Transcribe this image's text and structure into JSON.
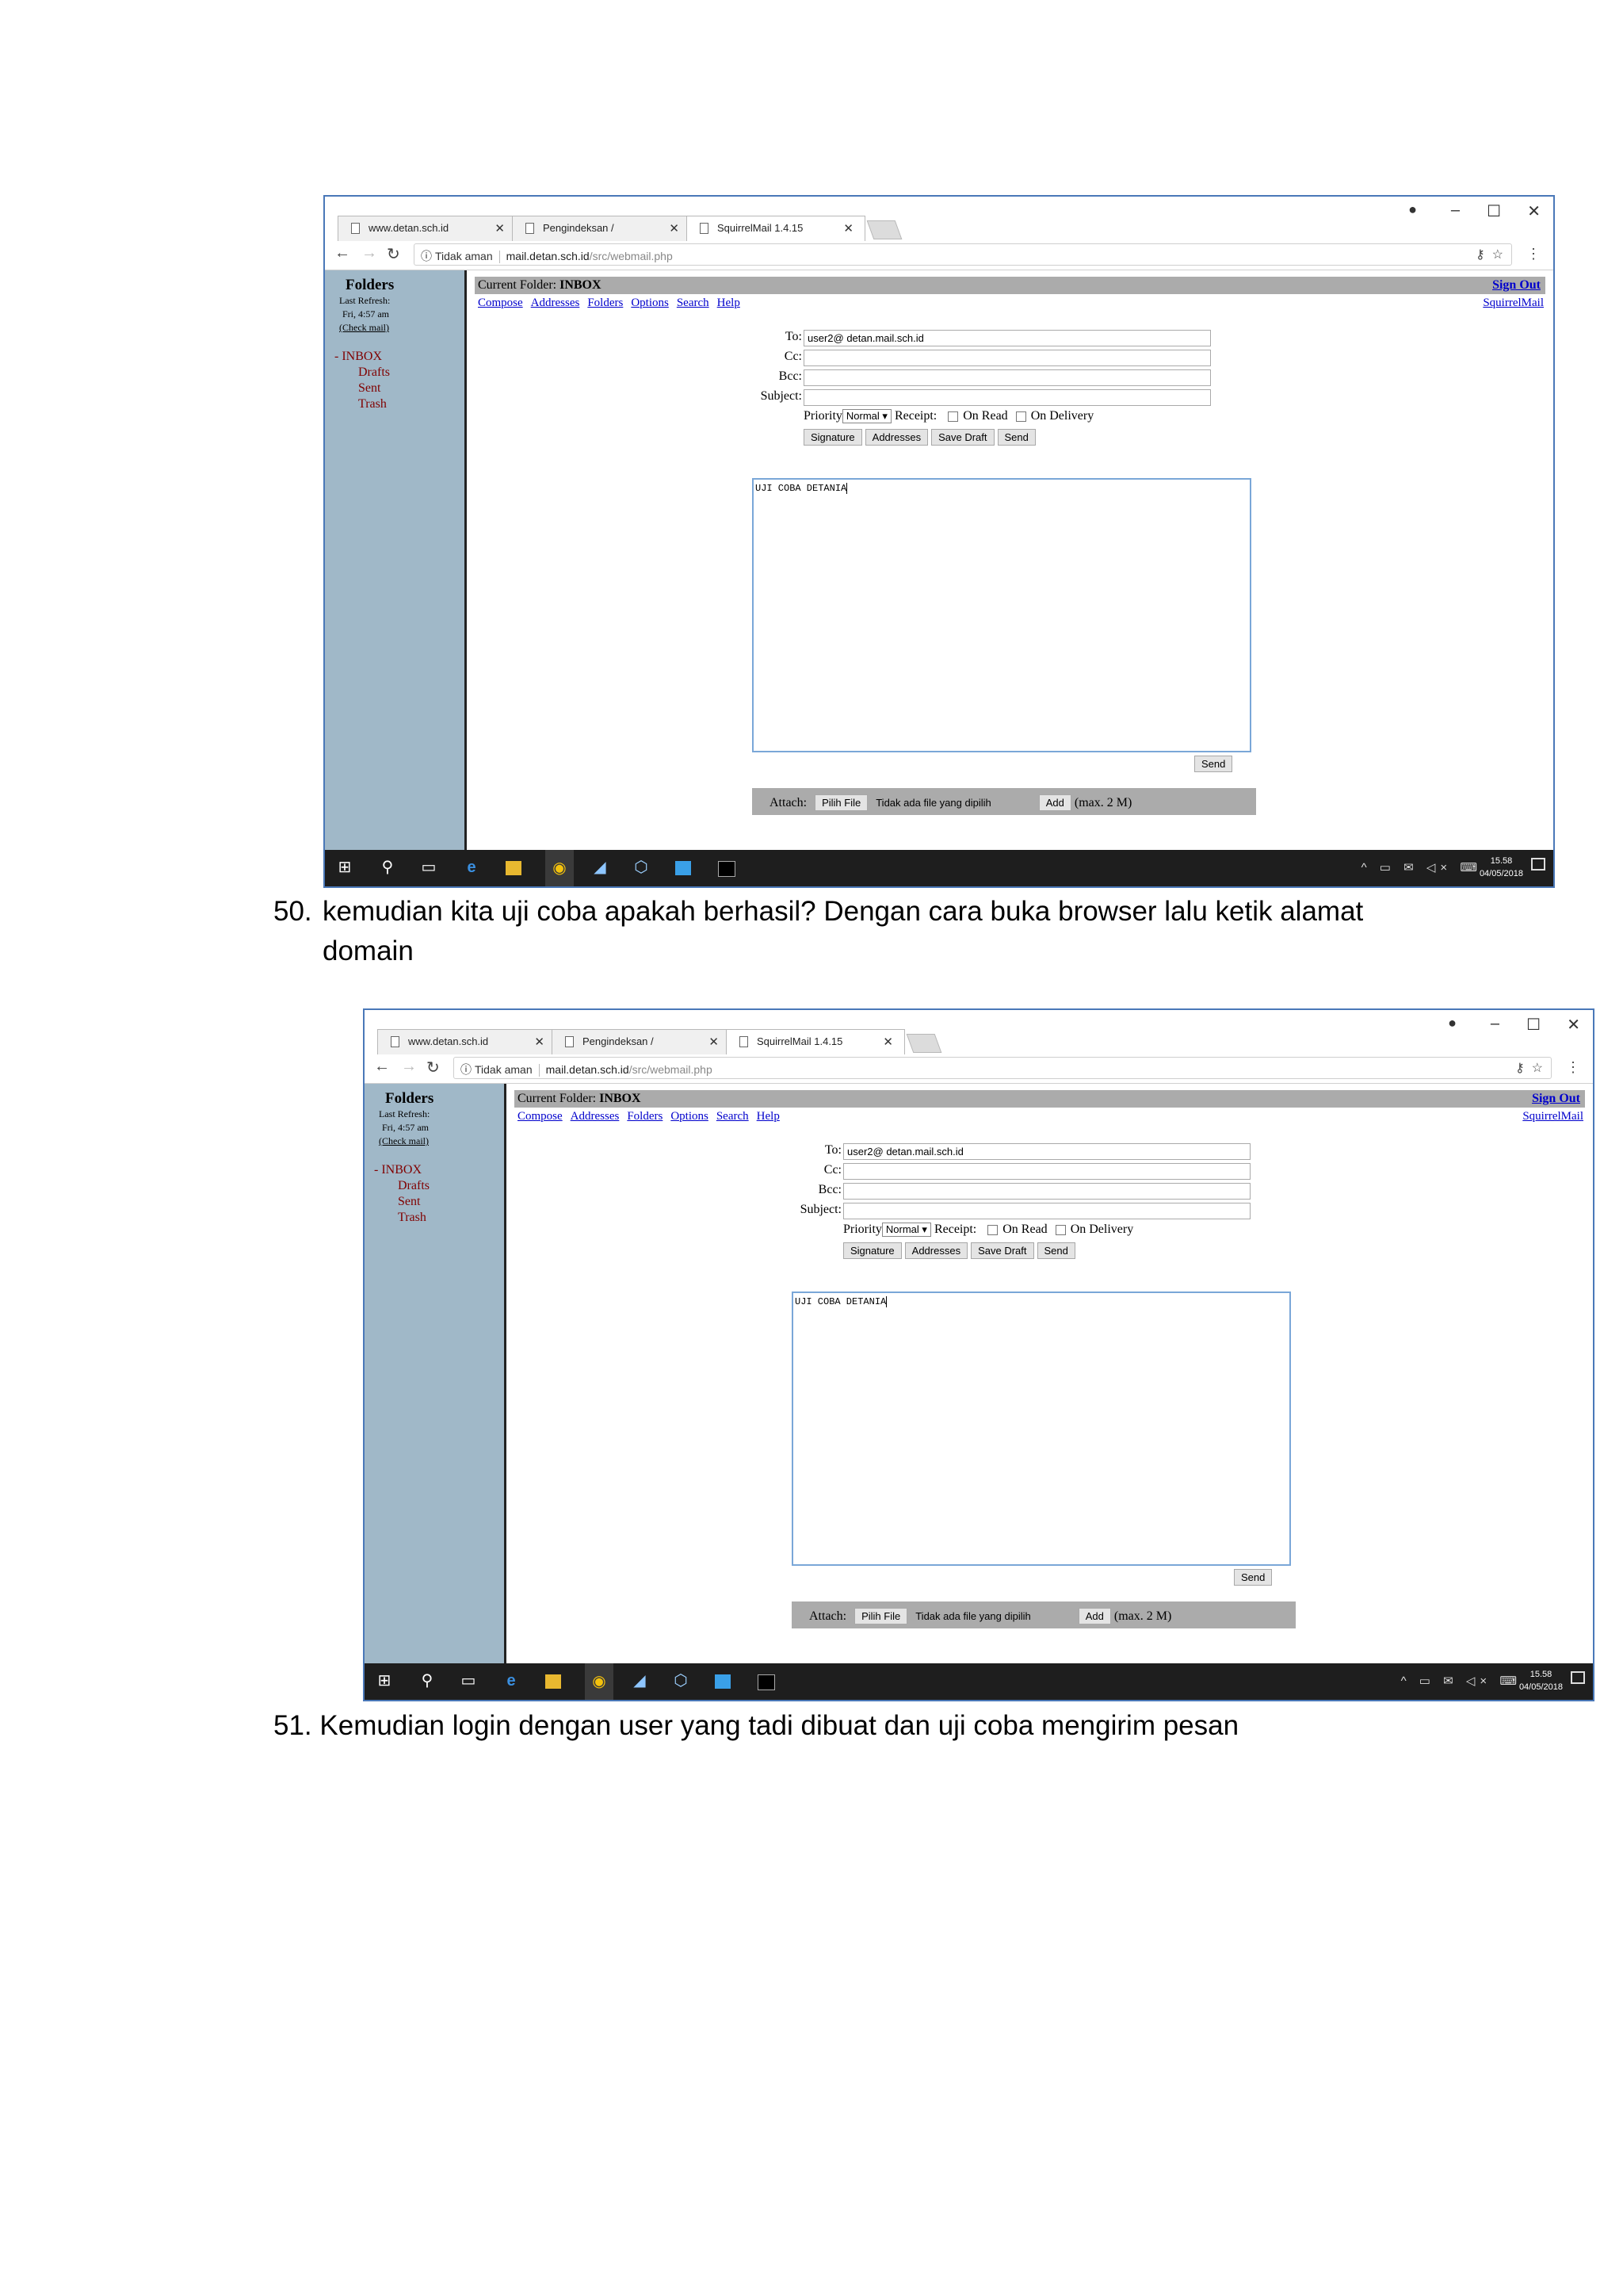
{
  "screenshots": [
    {
      "browser": {
        "tabs": [
          "www.detan.sch.id",
          "Pengindeksan /",
          "SquirrelMail 1.4.15"
        ],
        "omnibox": {
          "security": "Tidak aman",
          "host": "mail.detan.sch.id",
          "path": "/src/webmail.php"
        }
      },
      "sidebar": {
        "title": "Folders",
        "last_refresh": "Last Refresh:",
        "refresh_time": "Fri, 4:57 am",
        "check_mail": "(Check mail)",
        "folders": [
          "- INBOX",
          "Drafts",
          "Sent",
          "Trash"
        ]
      },
      "header": {
        "current_folder_label": "Current Folder:",
        "current_folder": "INBOX",
        "sign_out": "Sign Out",
        "menu": [
          "Compose",
          "Addresses",
          "Folders",
          "Options",
          "Search",
          "Help"
        ],
        "brand": "SquirrelMail"
      },
      "compose": {
        "to_label": "To:",
        "to_value": "user2@ detan.mail.sch.id",
        "cc_label": "Cc:",
        "bcc_label": "Bcc:",
        "subject_label": "Subject:",
        "priority_label": "Priority",
        "priority_value": "Normal ▾",
        "receipt_label": "Receipt:",
        "on_read": "On Read",
        "on_delivery": "On Delivery",
        "buttons": [
          "Signature",
          "Addresses",
          "Save Draft",
          "Send"
        ],
        "body": "UJI COBA DETANIA",
        "send_label": "Send",
        "attach_label": "Attach:",
        "choose_file": "Pilih File",
        "no_file": "Tidak ada file yang dipilih",
        "add_label": "Add",
        "max_size": "(max. 2 M)"
      },
      "taskbar": {
        "time": "15.58",
        "date": "04/05/2018"
      }
    },
    {
      "browser": {
        "tabs": [
          "www.detan.sch.id",
          "Pengindeksan /",
          "SquirrelMail 1.4.15"
        ],
        "omnibox": {
          "security": "Tidak aman",
          "host": "mail.detan.sch.id",
          "path": "/src/webmail.php"
        }
      },
      "sidebar": {
        "title": "Folders",
        "last_refresh": "Last Refresh:",
        "refresh_time": "Fri, 4:57 am",
        "check_mail": "(Check mail)",
        "folders": [
          "- INBOX",
          "Drafts",
          "Sent",
          "Trash"
        ]
      },
      "header": {
        "current_folder_label": "Current Folder:",
        "current_folder": "INBOX",
        "sign_out": "Sign Out",
        "menu": [
          "Compose",
          "Addresses",
          "Folders",
          "Options",
          "Search",
          "Help"
        ],
        "brand": "SquirrelMail"
      },
      "compose": {
        "to_label": "To:",
        "to_value": "user2@ detan.mail.sch.id",
        "cc_label": "Cc:",
        "bcc_label": "Bcc:",
        "subject_label": "Subject:",
        "priority_label": "Priority",
        "priority_value": "Normal ▾",
        "receipt_label": "Receipt:",
        "on_read": "On Read",
        "on_delivery": "On Delivery",
        "buttons": [
          "Signature",
          "Addresses",
          "Save Draft",
          "Send"
        ],
        "body": "UJI COBA DETANIA",
        "send_label": "Send",
        "attach_label": "Attach:",
        "choose_file": "Pilih File",
        "no_file": "Tidak ada file yang dipilih",
        "add_label": "Add",
        "max_size": "(max. 2 M)"
      },
      "taskbar": {
        "time": "15.58",
        "date": "04/05/2018"
      }
    }
  ],
  "captions": [
    {
      "number": "50.",
      "text_line1": "kemudian  kita uji coba apakah berhasil? Dengan cara buka browser lalu ketik alamat",
      "text_line2": "domain"
    },
    {
      "number": "51.",
      "text_line1": "Kemudian login dengan user yang tadi dibuat dan uji coba mengirim pesan"
    }
  ]
}
